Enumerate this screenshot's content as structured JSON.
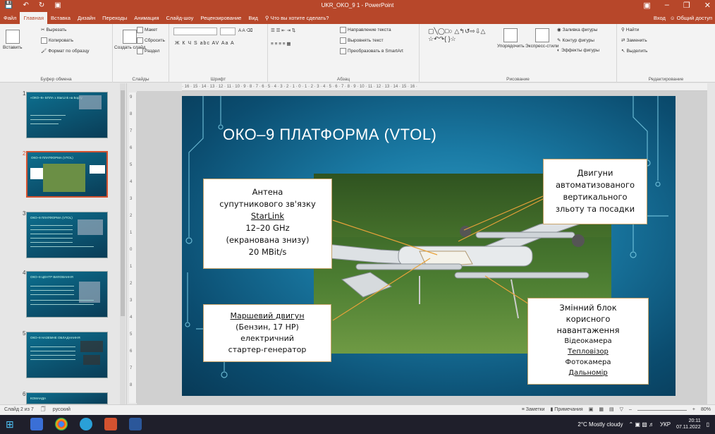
{
  "titlebar": {
    "title": "UKR_OKO_9 1 - PowerPoint",
    "controls": [
      "▣",
      "–",
      "❐",
      "✕"
    ]
  },
  "tabs": [
    "Файл",
    "Главная",
    "Вставка",
    "Дизайн",
    "Переходы",
    "Анимация",
    "Слайд-шоу",
    "Рецензирование",
    "Вид",
    "Что вы хотите сделать?"
  ],
  "tabs_right": {
    "login": "Вход",
    "share": "Общий доступ"
  },
  "ribbon": {
    "clipboard": {
      "paste": "Вставить",
      "cut": "Вырезать",
      "copy": "Копировать",
      "format": "Формат по образцу",
      "label": "Буфер обмена"
    },
    "slides": {
      "new": "Создать слайд",
      "layout": "Макет",
      "reset": "Сбросить",
      "section": "Раздел",
      "label": "Слайды"
    },
    "font": {
      "label": "Шрифт",
      "buttons": "Ж К Ч S abc AV Aa A"
    },
    "paragraph": {
      "dir": "Направление текста",
      "align": "Выровнять текст",
      "smartart": "Преобразовать в SmartArt",
      "label": "Абзац"
    },
    "drawing": {
      "arrange": "Упорядочить",
      "styles": "Экспресс-стили",
      "fill": "Заливка фигуры",
      "outline": "Контур фигуры",
      "effects": "Эффекты фигуры",
      "label": "Рисование"
    },
    "editing": {
      "find": "Найти",
      "replace": "Заменить",
      "select": "Выделить",
      "label": "Редактирование"
    }
  },
  "thumbs": [
    {
      "num": "1",
      "title": "«ОКО–9» БПЛА  з  StarLink  на Борту"
    },
    {
      "num": "2",
      "title": "ОКО–9 ПЛАТФОРМА (VTOL)"
    },
    {
      "num": "3",
      "title": "ОКО–9 ПЛАТФОРМА (VTOL)"
    },
    {
      "num": "4",
      "title": "ОКО–9 ЦЕНТР ВИЛОВАННЯ"
    },
    {
      "num": "5",
      "title": "ОКО–9 НАЗЕМНЕ ОБЛАДНАННЯ"
    },
    {
      "num": "6",
      "title": "КОМАНДА"
    }
  ],
  "ruler_h": "· 16 · 15 · 14 · 13 · 12 · 11 · 10 · 9 · 8 · 7 · 6 · 5 · 4 · 3 · 2 · 1 · 0 · 1 · 2 · 3 · 4 · 5 · 6 · 7 · 8 · 9 · 10 · 11 · 12 · 13 · 14 · 15 · 16 ·",
  "ruler_v": [
    "9",
    "8",
    "7",
    "6",
    "5",
    "4",
    "3",
    "2",
    "1",
    "0",
    "1",
    "2",
    "3",
    "4",
    "5",
    "6",
    "7",
    "8",
    "9"
  ],
  "slide": {
    "title": "ОКО–9 ПЛАТФОРМА (VTOL)",
    "antenna": [
      "Антена",
      "супутникового зв'язку",
      "StarLink",
      "12–20 GHz",
      "(екранована знизу)",
      "20 MBit/s"
    ],
    "engines": [
      "Двигуни",
      "автоматизованого",
      "вертикального",
      "зльоту та посадки"
    ],
    "march": [
      "Маршевий двигун",
      "(Бензин, 17 HP)",
      "електричний",
      "стартер-генератор"
    ],
    "payload": [
      "Змінний блок",
      "корисного",
      "навантаження",
      "Відеокамера",
      "Тепловізор",
      "Фотокамера",
      "Дальномір"
    ]
  },
  "status": {
    "slide": "Слайд 2 из 7",
    "lang": "русский",
    "notes": "Заметки",
    "comments": "Примечания",
    "zoom": "80%"
  },
  "taskbar": {
    "weather": "2°C  Mostly cloudy",
    "lang": "УКР",
    "time": "20:11",
    "date": "07.11.2022"
  },
  "bg_text": {
    "a": "O",
    "b": "ol",
    "c": "r"
  },
  "colors": {
    "accent": "#b7472a",
    "slide_dark": "#083a57",
    "callout_border": "#c9a46a"
  }
}
